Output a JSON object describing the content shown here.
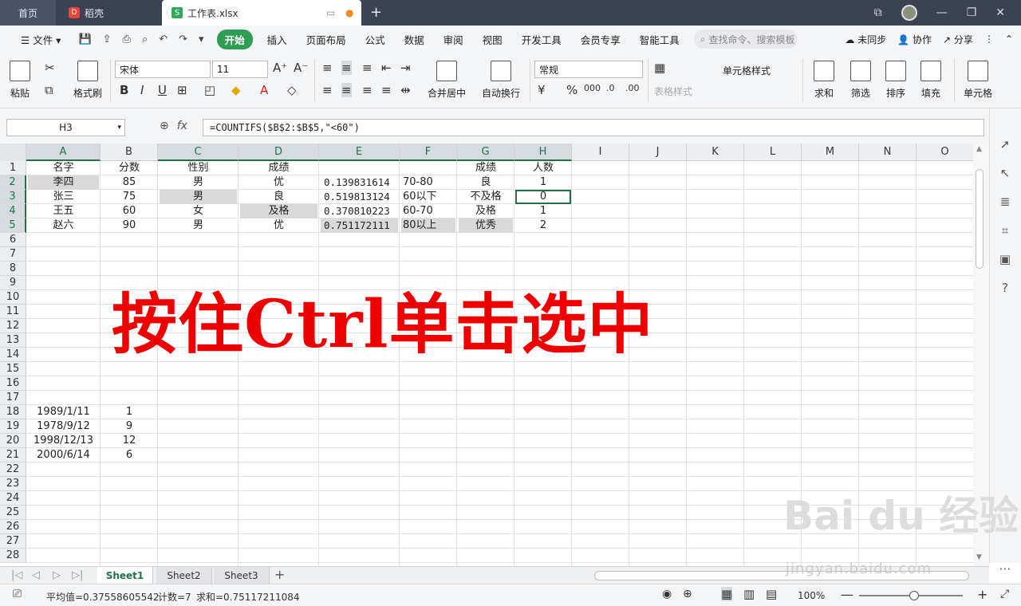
{
  "tabs": {
    "home": "首页",
    "daoke": "稻壳",
    "file": "工作表.xlsx",
    "file_icon": "S",
    "daoke_icon": "D"
  },
  "menu": {
    "file": "文件",
    "items": [
      "开始",
      "插入",
      "页面布局",
      "公式",
      "数据",
      "审阅",
      "视图",
      "开发工具",
      "会员专享",
      "智能工具"
    ],
    "search": "查找命令、搜索模板",
    "sync": "未同步",
    "collab": "协作",
    "share": "分享"
  },
  "ribbon": {
    "paste": "粘贴",
    "format_painter": "格式刷",
    "font": "宋体",
    "size": "11",
    "merge": "合并居中",
    "wrap": "自动换行",
    "numfmt": "常规",
    "cell_style": "单元格样式",
    "table_style": "表格样式",
    "sum": "求和",
    "filter": "筛选",
    "sort": "排序",
    "fill": "填充",
    "cell": "单元格"
  },
  "formula_bar": {
    "name_box": "H3",
    "fx": "fx",
    "formula": "=COUNTIFS($B$2:$B$5,\"<60\")"
  },
  "columns": [
    "A",
    "B",
    "C",
    "D",
    "E",
    "F",
    "G",
    "H",
    "I",
    "J",
    "K",
    "L",
    "M",
    "N",
    "O"
  ],
  "rows": [
    "1",
    "2",
    "3",
    "4",
    "5",
    "6",
    "7",
    "8",
    "9",
    "10",
    "11",
    "12",
    "13",
    "14",
    "15",
    "16",
    "17",
    "18",
    "19",
    "20",
    "21",
    "22",
    "23",
    "24",
    "25",
    "26",
    "27",
    "28"
  ],
  "cells": {
    "r1": [
      "名字",
      "分数",
      "性别",
      "成绩",
      "",
      "",
      "成绩",
      "人数"
    ],
    "r2": [
      "李四",
      "85",
      "男",
      "优",
      "0.139831614",
      "70-80",
      "良",
      "1"
    ],
    "r3": [
      "张三",
      "75",
      "男",
      "良",
      "0.519813124",
      "60以下",
      "不及格",
      "0"
    ],
    "r4": [
      "王五",
      "60",
      "女",
      "及格",
      "0.370810223",
      "60-70",
      "及格",
      "1"
    ],
    "r5": [
      "赵六",
      "90",
      "男",
      "优",
      "0.751172111",
      "80以上",
      "优秀",
      "2"
    ],
    "r18": [
      "1989/1/11",
      "1"
    ],
    "r19": [
      "1978/9/12",
      "9"
    ],
    "r20": [
      "1998/12/13",
      "12"
    ],
    "r21": [
      "2000/6/14",
      "6"
    ]
  },
  "overlay_text": "按住Ctrl单击选中",
  "sheets": [
    "Sheet1",
    "Sheet2",
    "Sheet3"
  ],
  "status": {
    "avg": "平均值=0.37558605542",
    "count": "计数=7",
    "sum": "求和=0.75117211084",
    "zoom": "100%"
  },
  "watermark": {
    "main": "Bai du 经验",
    "sub": "jingyan.baidu.com"
  }
}
